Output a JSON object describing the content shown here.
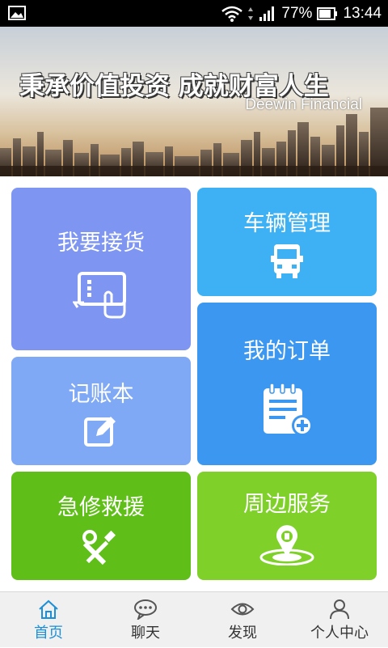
{
  "status_bar": {
    "battery_percent": "77%",
    "time": "13:44",
    "icons": [
      "image-icon",
      "wifi-icon",
      "signal-icon",
      "battery-icon"
    ]
  },
  "banner": {
    "slogan": "秉承价值投资 成就财富人生",
    "subtitle": "Deewin Financial"
  },
  "tiles": {
    "receive_goods": {
      "label": "我要接货",
      "color": "#7e96f2",
      "icon": "tablet-touch-icon"
    },
    "vehicle_management": {
      "label": "车辆管理",
      "color": "#3eb1f5",
      "icon": "truck-icon"
    },
    "my_orders": {
      "label": "我的订单",
      "color": "#3b97ef",
      "icon": "order-note-icon"
    },
    "ledger": {
      "label": "记账本",
      "color": "#7fa8f5",
      "icon": "edit-icon"
    },
    "roadside_rescue": {
      "label": "急修救援",
      "color": "#5fbf18",
      "icon": "tools-icon"
    },
    "nearby_services": {
      "label": "周边服务",
      "color": "#7fd12a",
      "icon": "map-pin-icon"
    }
  },
  "tab_bar": {
    "items": [
      {
        "label": "首页",
        "icon": "home-icon",
        "active": true
      },
      {
        "label": "聊天",
        "icon": "chat-icon",
        "active": false
      },
      {
        "label": "发现",
        "icon": "eye-icon",
        "active": false
      },
      {
        "label": "个人中心",
        "icon": "person-icon",
        "active": false
      }
    ],
    "active_color": "#1b8fd8"
  }
}
